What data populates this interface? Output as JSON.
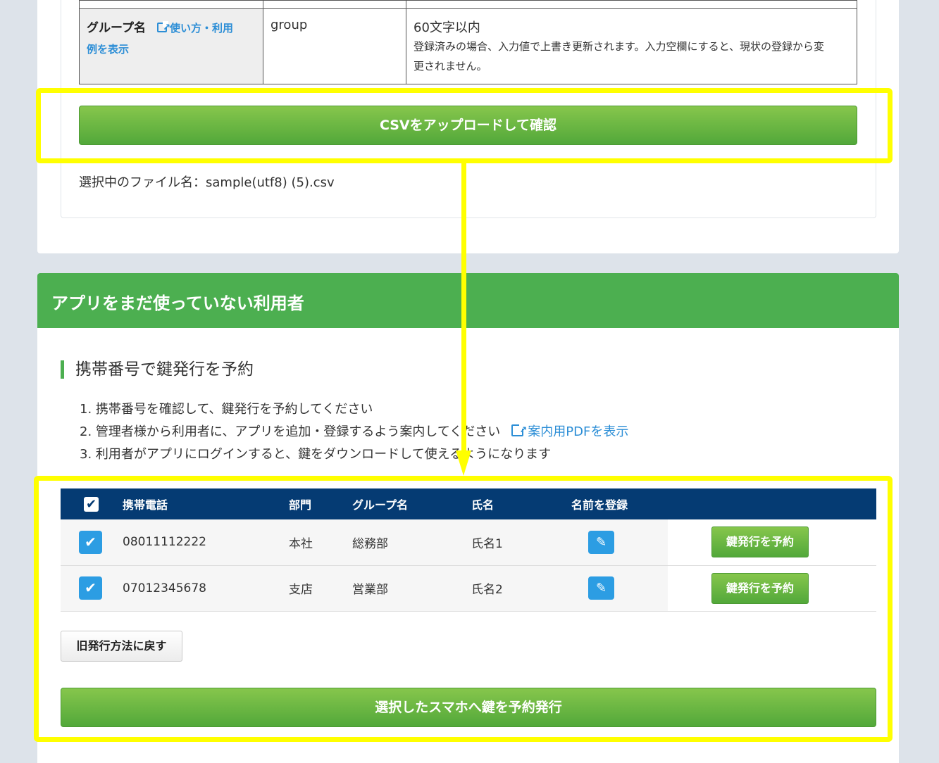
{
  "spec_table": {
    "row_label": "グループ名",
    "row_link": "使い方・利用例を表示",
    "row_link_line1": "使い方・利用",
    "row_link_line2": "例を表示",
    "field": "group",
    "limit": "60文字以内",
    "desc_line1": "登録済みの場合、入力値で上書き更新されます。入力空欄にすると、現状の登録から変",
    "desc_line2": "更されません。"
  },
  "upload": {
    "button_label": "CSVをアップロードして確認",
    "filename_text": "選択中のファイル名：sample(utf8) (5).csv"
  },
  "section": {
    "title": "アプリをまだ使っていない利用者",
    "subheading": "携帯番号で鍵発行を予約",
    "steps": [
      "1. 携帯番号を確認して、鍵発行を予約してください",
      "2. 管理者様から利用者に、アプリを追加・登録するよう案内してください",
      "3. 利用者がアプリにログインすると、鍵をダウンロードして使えるようになります"
    ],
    "pdf_link": "案内用PDFを表示"
  },
  "users_table": {
    "headers": {
      "phone": "携帯電話",
      "dept": "部門",
      "group": "グループ名",
      "name": "氏名",
      "register": "名前を登録"
    },
    "rows": [
      {
        "phone": "08011112222",
        "dept": "本社",
        "group": "総務部",
        "name": "氏名1",
        "action": "鍵発行を予約"
      },
      {
        "phone": "07012345678",
        "dept": "支店",
        "group": "営業部",
        "name": "氏名2",
        "action": "鍵発行を予約"
      }
    ]
  },
  "buttons": {
    "legacy": "旧発行方法に戻す",
    "issue_selected": "選択したスマホへ鍵を予約発行"
  },
  "colors": {
    "accent_green": "#4caf50",
    "table_header": "#053b73",
    "highlight": "#ffff00",
    "link_blue": "#2c8ed6"
  }
}
